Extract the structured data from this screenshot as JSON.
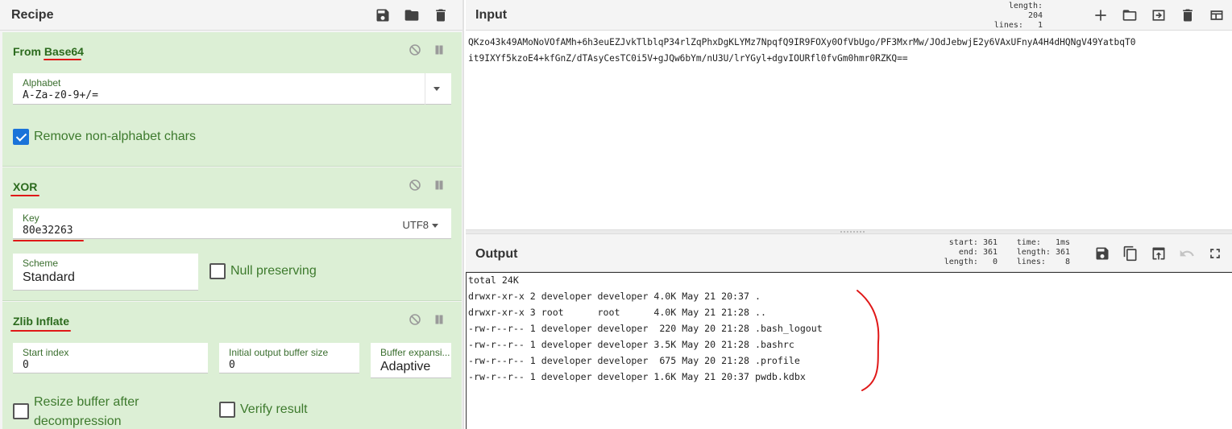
{
  "recipe": {
    "title": "Recipe",
    "operations": {
      "base64": {
        "name": "From Base64",
        "alphabet_label": "Alphabet",
        "alphabet_value": "A-Za-z0-9+/=",
        "remove_label": "Remove non-alphabet chars",
        "remove_checked": true
      },
      "xor": {
        "name": "XOR",
        "key_label": "Key",
        "key_value": "80e32263",
        "key_encoding": "UTF8",
        "scheme_label": "Scheme",
        "scheme_value": "Standard",
        "null_label": "Null preserving",
        "null_checked": false
      },
      "zlib": {
        "name": "Zlib Inflate",
        "start_label": "Start index",
        "start_value": "0",
        "initbuf_label": "Initial output buffer size",
        "initbuf_value": "0",
        "bufexp_label": "Buffer expansi...",
        "bufexp_value": "Adaptive",
        "resize_label_1": "Resize buffer after",
        "resize_label_2": "decompression",
        "verify_label": "Verify result"
      }
    }
  },
  "input": {
    "title": "Input",
    "length_label": "length:",
    "length_value": "204",
    "lines_label": "lines:",
    "lines_value": "1",
    "line1": "QKzo43k49AMoNoVOfAMh+6h3euEZJvkTlblqP34rlZqPhxDgKLYMz7NpqfQ9IR9FOXy0OfVbUgo/PF3MxrMw/JOdJebwjE2y6VAxUFnyA4H4dHQNgV49YatbqT0",
    "line2": "it9IXYf5kzoE4+kfGnZ/dTAsyCesTC0i5V+gJQw6bYm/nU3U/lrYGyl+dgvIOURfl0fvGm0hmr0RZKQ=="
  },
  "output": {
    "title": "Output",
    "start_label": "start:",
    "start_value": "361",
    "end_label": "end:",
    "end_value": "361",
    "length_label": "length:",
    "length_value": "0",
    "time_label": "time:",
    "time_value": "1ms",
    "olength_label": "length:",
    "olength_value": "361",
    "lines_label": "lines:",
    "lines_value": "8",
    "lines": [
      "total 24K",
      "drwxr-xr-x 2 developer developer 4.0K May 21 20:37 .",
      "drwxr-xr-x 3 root      root      4.0K May 21 21:28 ..",
      "-rw-r--r-- 1 developer developer  220 May 20 21:28 .bash_logout",
      "-rw-r--r-- 1 developer developer 3.5K May 20 21:28 .bashrc",
      "-rw-r--r-- 1 developer developer  675 May 20 21:28 .profile",
      "-rw-r--r-- 1 developer developer 1.6K May 21 20:37 pwdb.kdbx"
    ]
  },
  "colors": {
    "op_bg": "#dcefd5",
    "op_title": "#2b6a1d",
    "checkbox_on": "#1a73d9",
    "annotation": "#e01818"
  }
}
